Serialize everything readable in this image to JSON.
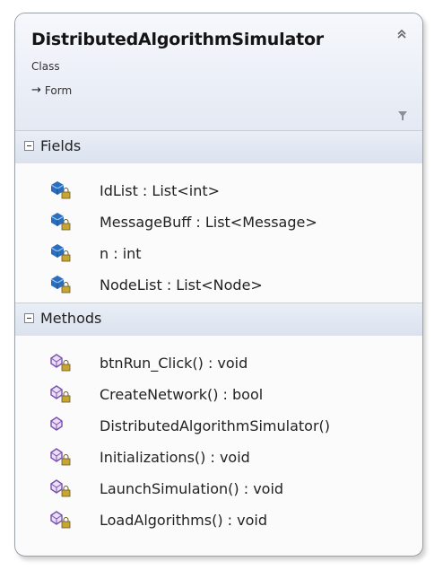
{
  "class_shape": {
    "name": "DistributedAlgorithmSimulator",
    "stereotype": "Class",
    "base_arrow": "→",
    "base_type": "Form",
    "colors": {
      "header_top": "#f6f8fc",
      "header_bottom": "#e4e9f3",
      "field_icon": "#2a6fbf",
      "method_icon": "#7a4fb0",
      "lock_badge": "#c8a430"
    }
  },
  "sections": {
    "fields": {
      "title": "Fields",
      "items": [
        {
          "label": "IdList : List<int>",
          "icon": "private-field-icon"
        },
        {
          "label": "MessageBuff : List<Message>",
          "icon": "private-field-icon"
        },
        {
          "label": "n : int",
          "icon": "private-field-icon"
        },
        {
          "label": "NodeList : List<Node>",
          "icon": "private-field-icon"
        }
      ]
    },
    "methods": {
      "title": "Methods",
      "items": [
        {
          "label": "btnRun_Click() : void",
          "icon": "private-method-icon"
        },
        {
          "label": "CreateNetwork() : bool",
          "icon": "private-method-icon"
        },
        {
          "label": "DistributedAlgorithmSimulator()",
          "icon": "public-method-icon"
        },
        {
          "label": "Initializations() : void",
          "icon": "private-method-icon"
        },
        {
          "label": "LaunchSimulation() : void",
          "icon": "private-method-icon"
        },
        {
          "label": "LoadAlgorithms() : void",
          "icon": "private-method-icon"
        }
      ]
    }
  }
}
